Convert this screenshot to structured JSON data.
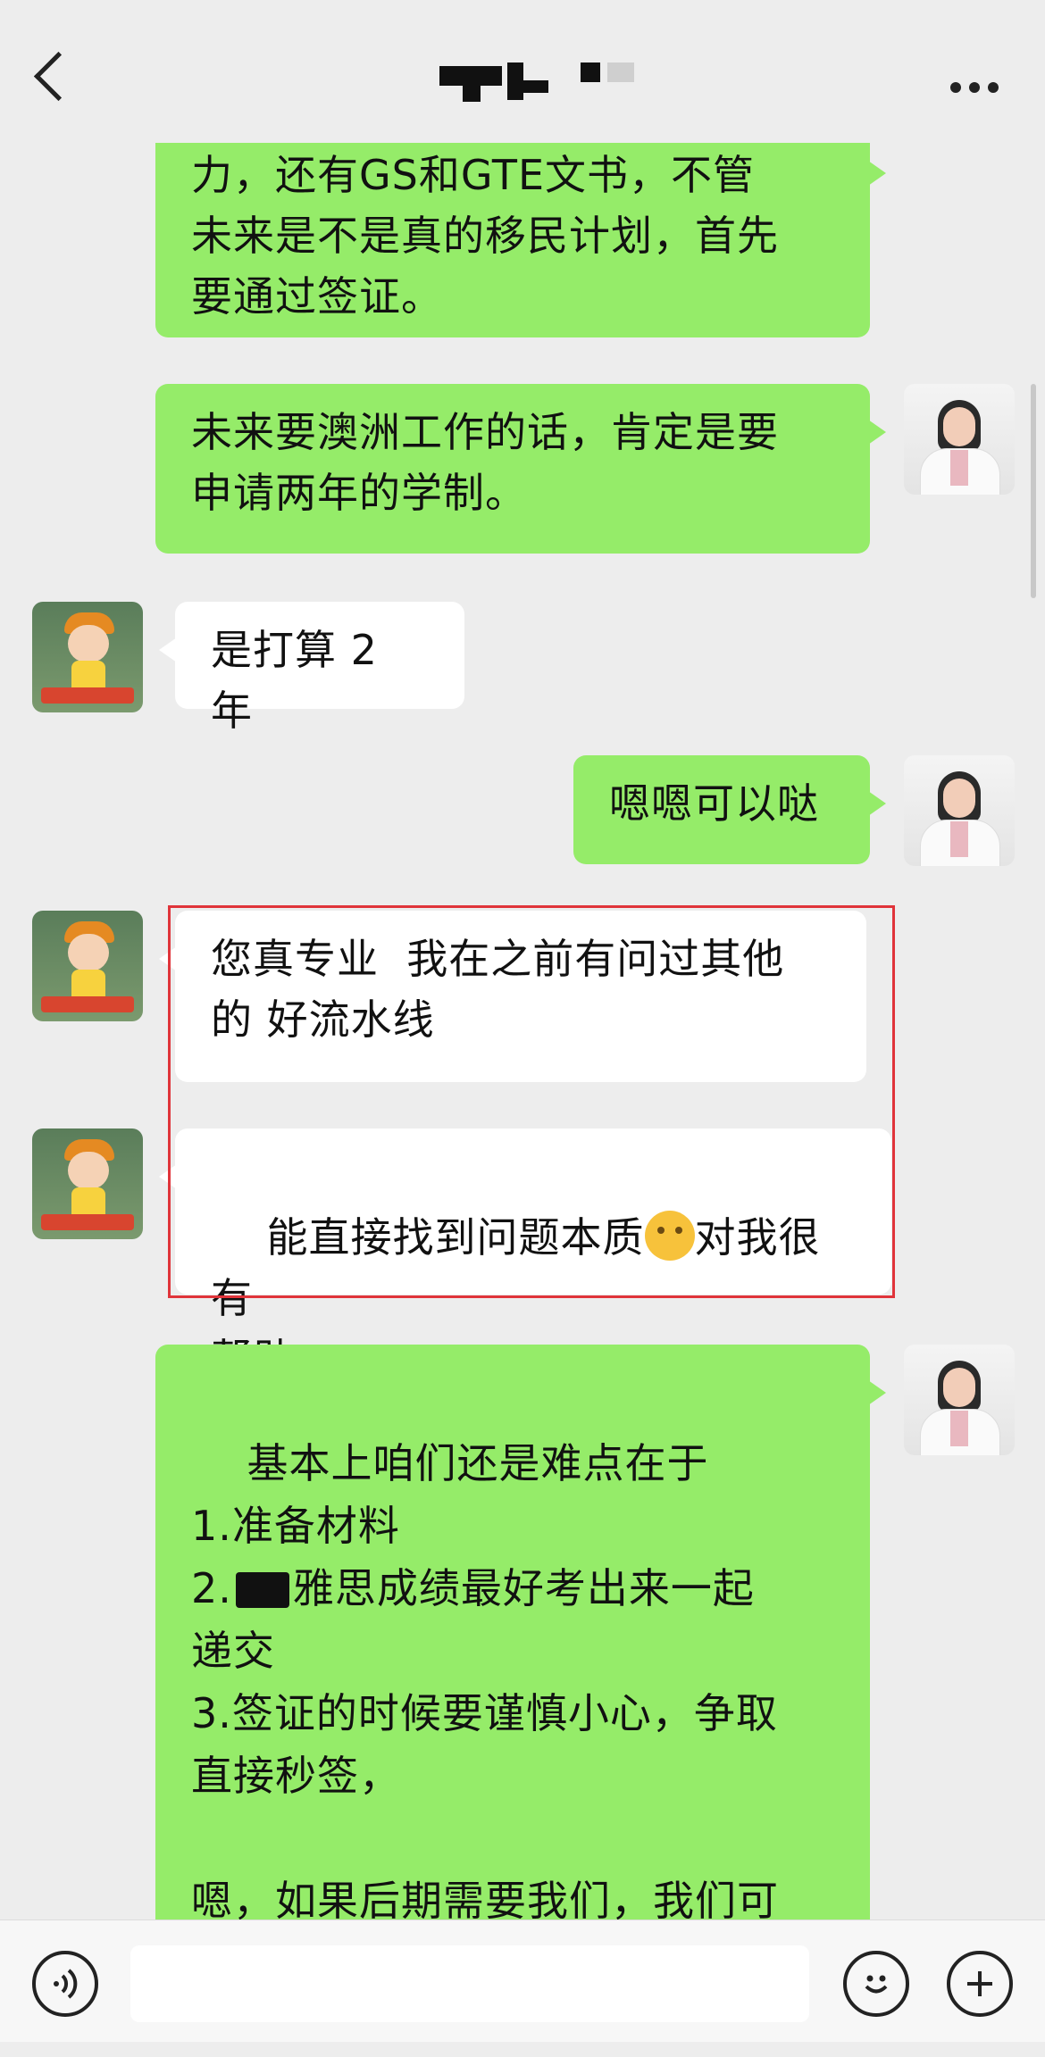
{
  "header": {
    "title": "",
    "back_icon": "chevron-left-icon",
    "more_icon": "more-horizontal-icon"
  },
  "messages": [
    {
      "side": "me",
      "text": "力，还有GS和GTE文书，不管\n未来是不是真的移民计划，首先\n要通过签证。"
    },
    {
      "side": "me",
      "text": "未来要澳洲工作的话，肯定是要\n申请两年的学制。"
    },
    {
      "side": "them",
      "text": "是打算 2 年"
    },
    {
      "side": "me",
      "text": "嗯嗯可以哒"
    },
    {
      "side": "them",
      "text": "您真专业  我在之前有问过其他\n的 好流水线"
    },
    {
      "side": "them",
      "text_a": "能直接找到问题本质",
      "emoji": "thinking-face",
      "text_b": "对我很有\n帮助"
    },
    {
      "side": "me",
      "line1": "基本上咱们还是难点在于\n1.准备材料\n2.",
      "line2": "雅思成绩最好考出来一起\n递交\n3.签证的时候要谨慎小心，争取\n直接秒签，\n\n嗯，如果后期需要我们，我们可\n以来负责你的整个全案的申请，"
    }
  ],
  "composer": {
    "voice_icon": "voice-icon",
    "emoji_icon": "emoji-icon",
    "plus_icon": "plus-icon",
    "input_value": ""
  },
  "colors": {
    "my_bubble": "#95ec69",
    "their_bubble": "#ffffff",
    "background": "#ededed",
    "highlight_border": "#e0343a"
  }
}
